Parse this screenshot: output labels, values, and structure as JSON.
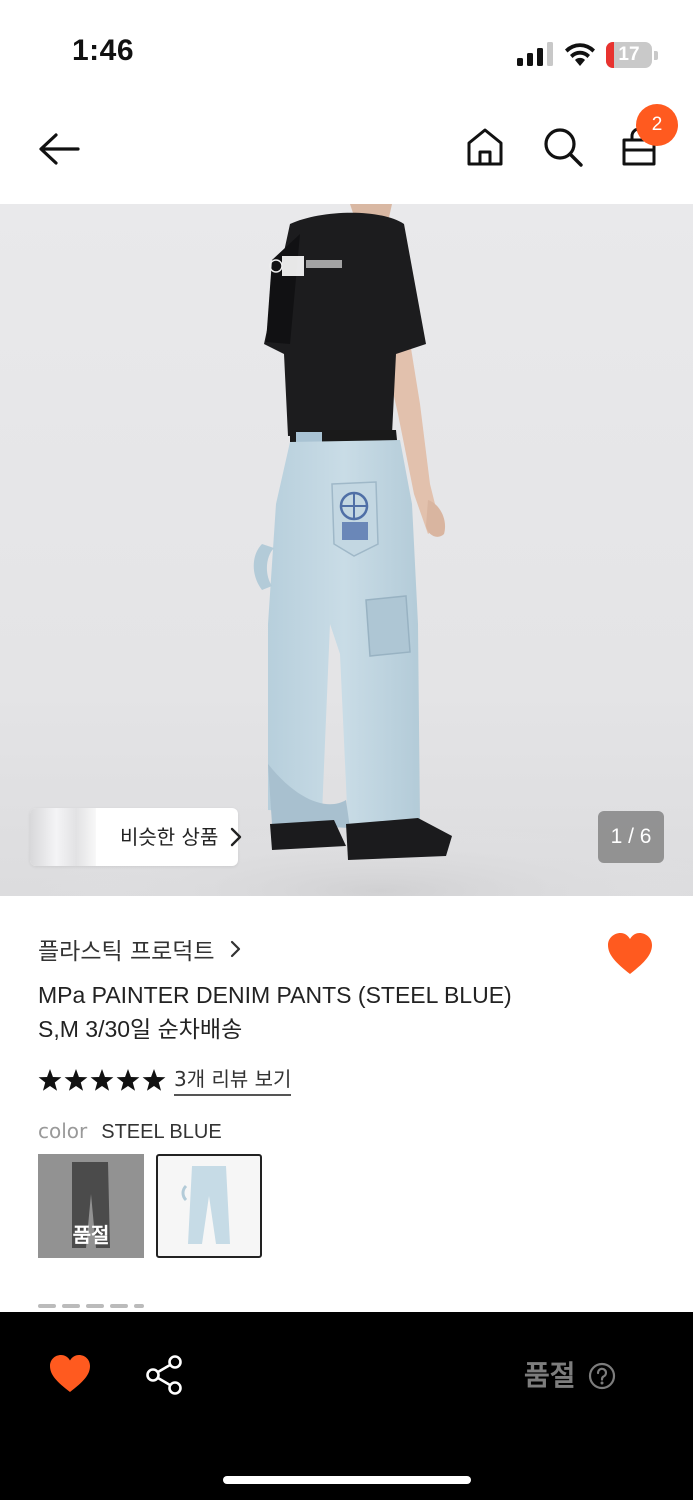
{
  "status_bar": {
    "time": "1:46",
    "battery_level": "17",
    "battery_fraction": 0.17,
    "battery_color": "#e8332f"
  },
  "nav": {
    "back_icon": "arrow-left-icon",
    "home_icon": "home-icon",
    "search_icon": "search-icon",
    "cart_icon": "shopping-bag-icon",
    "cart_count": "2",
    "badge_color": "#ff5a1f"
  },
  "gallery": {
    "similar_products_label": "비슷한 상품",
    "page_indicator": "1 / 6"
  },
  "product": {
    "brand": "플라스틱 프로덕트",
    "title_line1": "MPa PAINTER DENIM PANTS (STEEL BLUE)",
    "title_line2": "S,M 3/30일 순차배송",
    "rating_stars": 5,
    "review_link": "3개 리뷰 보기",
    "color_label": "color",
    "color_value": "STEEL BLUE",
    "swatches": [
      {
        "color": "charcoal",
        "status": "품절"
      },
      {
        "color": "steel-blue",
        "status": ""
      }
    ],
    "like_color": "#ff5a1f"
  },
  "bottom_bar": {
    "soldout_label": "품절",
    "accent_color": "#ff5a1f"
  }
}
